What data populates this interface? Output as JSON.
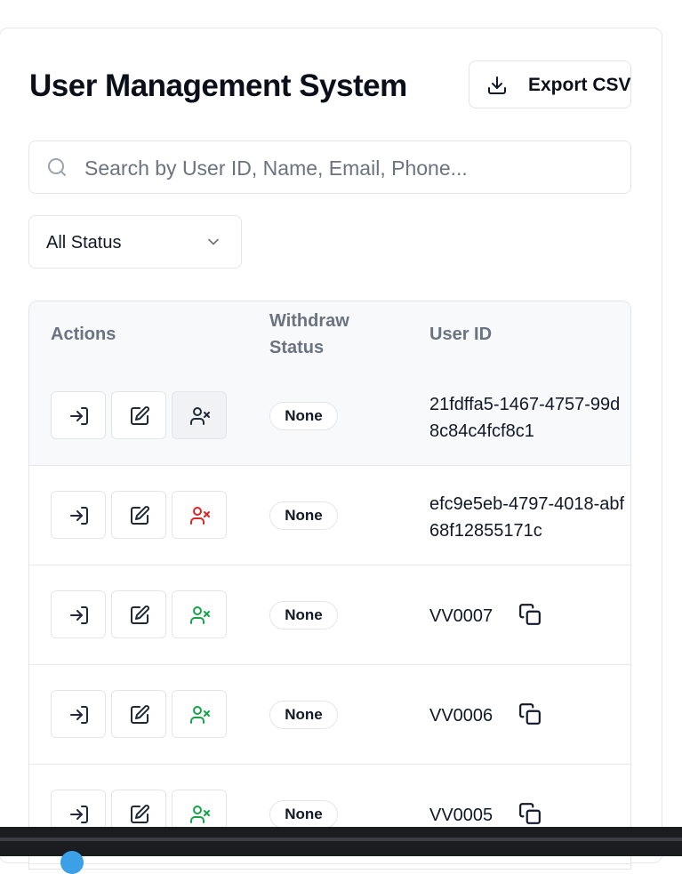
{
  "header": {
    "title": "User Management System",
    "export_label": "Export CSV",
    "export_icon": "download-icon"
  },
  "search": {
    "placeholder": "Search by User ID, Name, Email, Phone...",
    "value": ""
  },
  "filter": {
    "selected": "All Status"
  },
  "table": {
    "columns": {
      "actions": "Actions",
      "withdraw_line1": "Withdraw",
      "withdraw_line2": "Status",
      "user_id": "User ID"
    },
    "rows": [
      {
        "status": "None",
        "user_id_line1": "21fdffa5-1467-4757-99d",
        "user_id_line2": "8c84c4fcf8c1",
        "toggle_state": "neutral"
      },
      {
        "status": "None",
        "user_id_line1": "efc9e5eb-4797-4018-abf",
        "user_id_line2": "68f12855171c",
        "toggle_state": "danger"
      },
      {
        "status": "None",
        "user_id": "VV0007",
        "toggle_state": "success"
      },
      {
        "status": "None",
        "user_id": "VV0006",
        "toggle_state": "success"
      },
      {
        "status": "None",
        "user_id": "VV0005",
        "toggle_state": "success"
      }
    ]
  },
  "colors": {
    "neutral": "#1f2937",
    "danger": "#dc2626",
    "success": "#16a34a",
    "border": "#e2e5ea",
    "muted_text": "#6b7280"
  }
}
